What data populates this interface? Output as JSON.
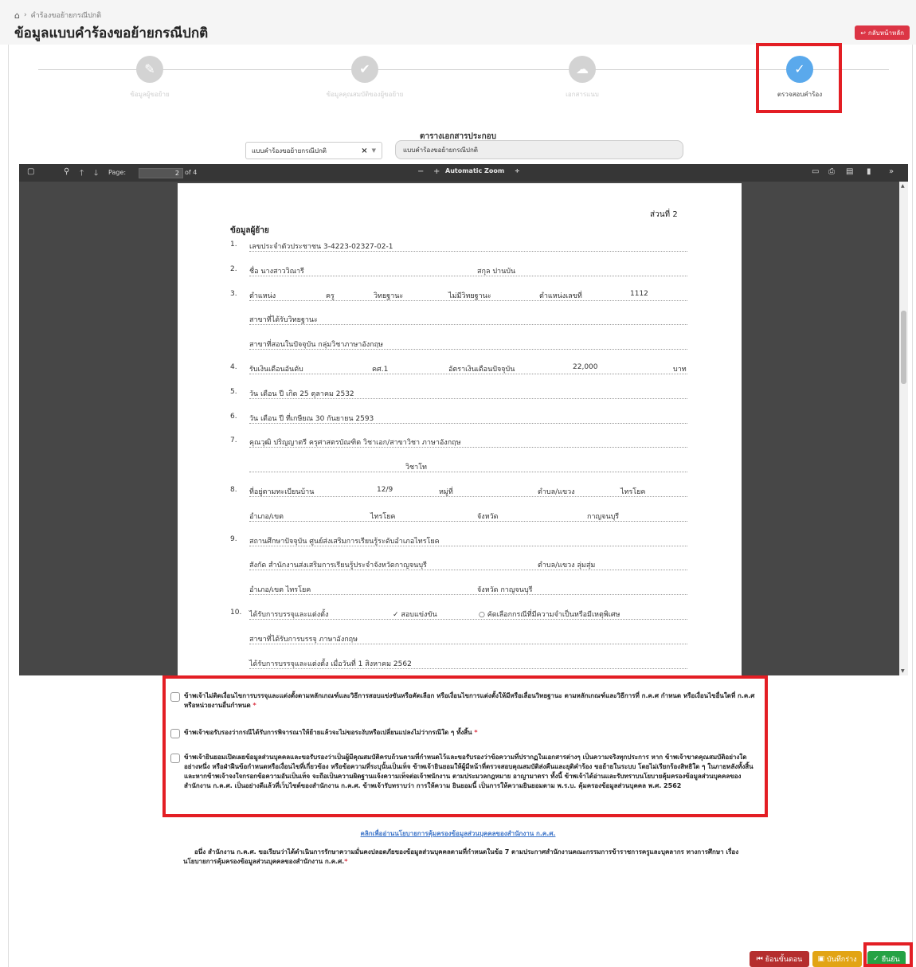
{
  "breadcrumb": {
    "current": "คำร้องขอย้ายกรณีปกติ"
  },
  "page_title": "ข้อมูลแบบคำร้องขอย้ายกรณีปกติ",
  "home_button": "กลับหน้าหลัก",
  "steps": [
    {
      "label": "ข้อมูลผู้ขอย้าย",
      "icon": "user-edit-icon",
      "active": false
    },
    {
      "label": "ข้อมูลคุณสมบัติของผู้ขอย้าย",
      "icon": "user-check-icon",
      "active": false
    },
    {
      "label": "เอกสารแนบ",
      "icon": "cloud-download-icon",
      "active": false
    },
    {
      "label": "ตรวจสอบคำร้อง",
      "icon": "check-icon",
      "active": true
    }
  ],
  "docs": {
    "title": "ตารางเอกสารประกอบ",
    "select_value": "แบบคำร้องขอย้ายกรณีปกติ",
    "doc_name": "แบบคำร้องขอย้ายกรณีปกติ"
  },
  "viewer": {
    "page_label": "Page:",
    "page_current": "2",
    "page_total": "of 4",
    "zoom": "Automatic Zoom"
  },
  "pdf": {
    "part": "ส่วนที่ 2",
    "section": "ข้อมูลผู้ย้าย",
    "rows": [
      {
        "n": "1.",
        "t": [
          [
            "เลขประจำตัวประชาชน  3-4223-02327-02-1",
            24
          ]
        ]
      },
      {
        "n": "2.",
        "t": [
          [
            "ชื่อ  นางสาววิณารี",
            24
          ],
          [
            "สกุล  ปานบัน",
            310
          ]
        ]
      },
      {
        "n": "3.",
        "t": [
          [
            "ตำแหน่ง",
            24
          ],
          [
            "ครู",
            120
          ],
          [
            "วิทยฐานะ",
            180
          ],
          [
            "ไม่มีวิทยฐานะ",
            274
          ],
          [
            "ตำแหน่งเลขที่",
            388
          ],
          [
            "1112",
            502
          ]
        ]
      },
      {
        "n": "",
        "t": [
          [
            "สาขาที่ได้รับวิทยฐานะ",
            24
          ]
        ]
      },
      {
        "n": "",
        "t": [
          [
            "สาขาที่สอนในปัจจุบัน  กลุ่มวิชาภาษาอังกฤษ",
            24
          ]
        ]
      },
      {
        "n": "4.",
        "t": [
          [
            "รับเงินเดือนอันดับ",
            24
          ],
          [
            "คศ.1",
            178
          ],
          [
            "อัตราเงินเดือนปัจจุบัน",
            274
          ],
          [
            "22,000",
            430
          ],
          [
            "บาท",
            556
          ]
        ]
      },
      {
        "n": "5.",
        "t": [
          [
            "วัน เดือน ปี เกิด  25 ตุลาคม 2532",
            24
          ]
        ]
      },
      {
        "n": "6.",
        "t": [
          [
            "วัน เดือน ปี ที่เกษียณ  30 กันยายน 2593",
            24
          ]
        ]
      },
      {
        "n": "7.",
        "t": [
          [
            "คุณวุฒิ  ปริญญาตรี  ครุศาสตรบัณฑิต  วิชาเอก/สาขาวิชา  ภาษาอังกฤษ",
            24
          ]
        ]
      },
      {
        "n": "",
        "t": [
          [
            "วิชาโท",
            220
          ]
        ]
      },
      {
        "n": "8.",
        "t": [
          [
            "ที่อยู่ตามทะเบียนบ้าน",
            24
          ],
          [
            "12/9",
            184
          ],
          [
            "หมู่ที่",
            262
          ],
          [
            "ตำบล/แขวง",
            386
          ],
          [
            "ไทรโยค",
            490
          ]
        ]
      },
      {
        "n": "",
        "t": [
          [
            "อำเภอ/เขต",
            24
          ],
          [
            "ไทรโยค",
            176
          ],
          [
            "จังหวัด",
            310
          ],
          [
            "กาญจนบุรี",
            448
          ]
        ]
      },
      {
        "n": "9.",
        "t": [
          [
            "สถานศึกษาปัจจุบัน  ศูนย์ส่งเสริมการเรียนรู้ระดับอำเภอไทรโยค",
            24
          ]
        ]
      },
      {
        "n": "",
        "t": [
          [
            "สังกัด  สำนักงานส่งเสริมการเรียนรู้ประจำจังหวัดกาญจนบุรี",
            24
          ],
          [
            "ตำบล/แขวง  ลุ่มสุ่ม",
            386
          ]
        ]
      },
      {
        "n": "",
        "t": [
          [
            "อำเภอ/เขต  ไทรโยค",
            24
          ],
          [
            "จังหวัด  กาญจนบุรี",
            310
          ]
        ]
      },
      {
        "n": "10.",
        "t": [
          [
            "ได้รับการบรรจุและแต่งตั้ง",
            24
          ],
          [
            "✓  สอบแข่งขัน",
            204
          ],
          [
            "○  คัดเลือกกรณีที่มีความจำเป็นหรือมีเหตุพิเศษ",
            312
          ]
        ]
      },
      {
        "n": "",
        "t": [
          [
            "สาขาที่ได้รับการบรรจุ  ภาษาอังกฤษ",
            24
          ]
        ]
      },
      {
        "n": "",
        "t": [
          [
            "ได้รับการบรรจุและแต่งตั้ง  เมื่อวันที่  1 สิงหาคม 2562",
            24
          ]
        ]
      }
    ]
  },
  "declarations": [
    {
      "text": "ข้าพเจ้าไม่ติดเงื่อนไขการบรรจุและแต่งตั้งตามหลักเกณฑ์และวิธีการสอบแข่งขันหรือคัดเลือก หรือเงื่อนไขการแต่งตั้งให้มีหรือเลื่อนวิทยฐานะ ตามหลักเกณฑ์และวิธีการที่ ก.ค.ศ กำหนด หรือเงื่อนไขอื่นใดที่ ก.ค.ศ หรือหน่วยงานอื่นกำหนด",
      "required": "*"
    },
    {
      "text": "ข้าพเจ้าขอรับรองว่ากรณีได้รับการพิจารณาให้ย้ายแล้วจะไม่ขอระงับหรือเปลี่ยนแปลงไม่ว่ากรณีใด ๆ ทั้งสิ้น",
      "required": "*"
    },
    {
      "text": "ข้าพเจ้ายินยอมเปิดเผยข้อมูลส่วนบุคคลและขอรับรองว่าเป็นผู้มีคุณสมบัติครบถ้วนตามที่กำหนดไว้และขอรับรองว่าข้อความที่ปรากฏในเอกสารต่างๆ เป็นความจริงทุกประการ หาก ข้าพเจ้าขาดคุณสมบัติอย่างใดอย่างหนึ่ง หรือฝ่าฝืนข้อกำหนดหรือเงื่อนไขที่เกี่ยวข้อง หรือข้อความที่ระบุนั้นเป็นเท็จ ข้าพเจ้ายินยอมให้ผู้มีหน้าที่ตรวจสอบคุณสมบัติส่งคืนและยุติคำร้อง ขอย้ายในระบบ โดยไม่เรียกร้องสิทธิใด ๆ ในภายหลังทั้งสิ้น และหากข้าพเจ้าจงใจกรอกข้อความอันเป็นเท็จ จะถือเป็นความผิดฐานแจ้งความเท็จต่อเจ้าพนักงาน ตามประมวลกฎหมาย อาญามาตรา ทั้งนี้ ข้าพเจ้าได้อ่านและรับทราบนโยบายคุ้มครองข้อมูลส่วนบุคคลของสำนักงาน ก.ค.ศ. เป็นอย่างดีแล้วที่เว็บไซต์ของสำนักงาน ก.ค.ศ. ข้าพเจ้ารับทราบว่า การให้ความ ยินยอมนี้ เป็นการให้ความยินยอมตาม พ.ร.บ. คุ้มครองข้อมูลส่วนบุคคล พ.ศ. 2562",
      "required": ""
    }
  ],
  "policy_link": "คลิกเพื่ออ่านนโยบายการคุ้มครองข้อมูลส่วนบุคคลของสำนักงาน ก.ค.ศ.",
  "notice": {
    "text": "อนึ่ง สำนักงาน ก.ค.ศ. ขอเรียนว่าได้ดำเนินการรักษาความมั่นคงปลอดภัยของข้อมูลส่วนบุคคลตามที่กำหนดในข้อ 7 ตามประกาศสำนักงานคณะกรรมการข้าราชการครูและบุคลากร ทางการศึกษา เรื่อง นโยบายการคุ้มครองข้อมูลส่วนบุคคลของสำนักงาน ก.ค.ศ.",
    "required": "*"
  },
  "buttons": {
    "back": "ย้อนขั้นตอน",
    "draft": "บันทึกร่าง",
    "confirm": "ยืนยัน"
  },
  "colors": {
    "active_step": "#5aa9ec",
    "highlight": "#e31e24",
    "back": "#b52e2e",
    "draft": "#e2a414",
    "confirm": "#25a244",
    "home": "#dc3545"
  }
}
